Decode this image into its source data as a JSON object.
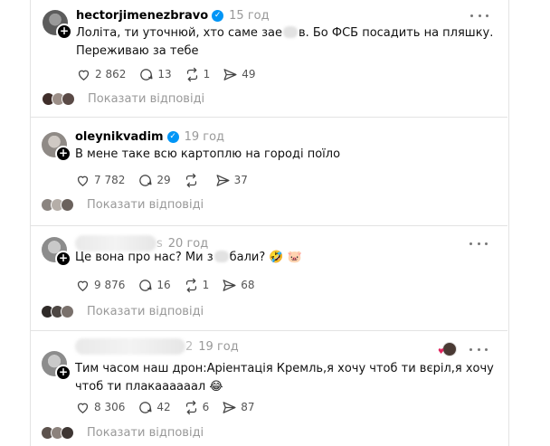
{
  "posts": [
    {
      "username": "hectorjimenezbravo",
      "verified": true,
      "time": "15 год",
      "text_before": "Лоліта, ти уточнюй, хто саме зае",
      "text_after": "в. Бо ФСБ посадить на пляшку. Переживаю за тебе",
      "likes": "2 862",
      "comments": "13",
      "reposts": "1",
      "shares": "49",
      "replies_label": "Показати відповіді"
    },
    {
      "username": "oleynikvadim",
      "verified": true,
      "time": "19 год",
      "text": "В мене таке всю картоплю на городі поїло",
      "likes": "7 782",
      "comments": "29",
      "shares": "37",
      "replies_label": "Показати відповіді"
    },
    {
      "username_visible": "s",
      "time": "20 год",
      "text_before": "Це вона про нас? Ми з",
      "text_after": "бали? 🤣 🐷",
      "likes": "9 876",
      "comments": "16",
      "reposts": "1",
      "shares": "68",
      "replies_label": "Показати відповіді"
    },
    {
      "username_visible": "2",
      "time": "19 год",
      "text": "Тим часом наш дрон:Аріентація Кремль,я хочу чтоб ти вєріл,я хочу чтоб ти плакаааааал 😂",
      "likes": "8 306",
      "comments": "42",
      "reposts": "6",
      "shares": "87",
      "replies_label": "Показати відповіді"
    }
  ]
}
